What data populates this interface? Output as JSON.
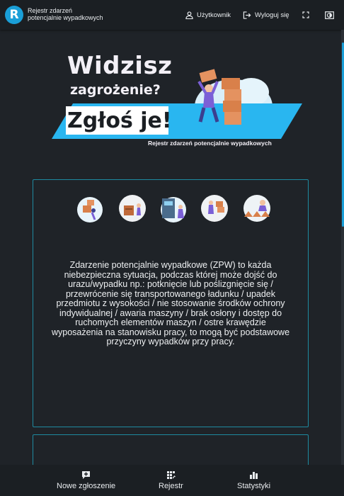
{
  "header": {
    "logo_letter": "R",
    "app_title_line1": "Rejestr zdarzeń",
    "app_title_line2": "potencjalnie wypadkowych",
    "user_label": "Użytkownik",
    "logout_label": "Wyloguj się",
    "fullscreen_icon": "fullscreen-icon",
    "contrast_icon": "contrast-icon"
  },
  "banner": {
    "line1": "Widzisz",
    "line2": "zagrożenie?",
    "line3": "Zgłoś je!",
    "subtitle": "Rejestr zdarzeń potencjalnie wypadkowych"
  },
  "info_card": {
    "description": "Zdarzenie potencjalnie wypadkowe (ZPW) to każda niebezpieczna sytuacja, podczas której może dojść do urazu/wypadku np.: potknięcie lub poślizgnięcie się / przewrócenie się transportowanego ładunku / upadek przedmiotu z wysokości / nie stosowanie środków ochrony indywidualnej / awaria maszyny / brak osłony i dostęp do ruchomych elementów maszyn / ostre krawędzie wyposażenia na stanowisku pracy, to mogą być podstawowe przyczyny wypadków przy pracy."
  },
  "bottom_nav": {
    "new_report": "Nowe zgłoszenie",
    "registry": "Rejestr",
    "statistics": "Statystyki"
  },
  "colors": {
    "accent": "#1a9fd8",
    "card_border": "#1e8aa0",
    "background": "#1f2328",
    "banner_stripe": "#29b6f0"
  }
}
